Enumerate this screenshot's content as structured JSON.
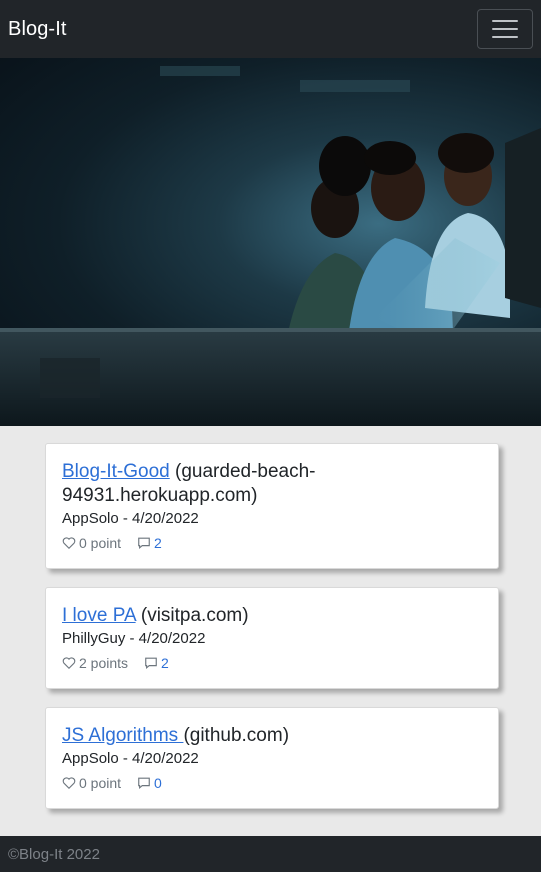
{
  "navbar": {
    "brand": "Blog-It",
    "menu_icon": "hamburger-menu-icon"
  },
  "hero": {
    "image": "people-at-computer-photo"
  },
  "posts": [
    {
      "title": "Blog-It-Good",
      "domain": "(guarded-beach-94931.herokuapp.com)",
      "meta": "AppSolo - 4/20/2022",
      "points": "0 point",
      "comments": "2"
    },
    {
      "title": "I love PA",
      "domain": "(visitpa.com)",
      "meta": "PhillyGuy - 4/20/2022",
      "points": "2 points",
      "comments": "2"
    },
    {
      "title": "JS Algorithms ",
      "domain": "(github.com)",
      "meta": "AppSolo - 4/20/2022",
      "points": "0 point",
      "comments": "0"
    }
  ],
  "footer": {
    "text": "©Blog-It 2022"
  },
  "colors": {
    "navbar": "#212529",
    "link": "#2d6fd6",
    "background": "#e9e9e9"
  }
}
